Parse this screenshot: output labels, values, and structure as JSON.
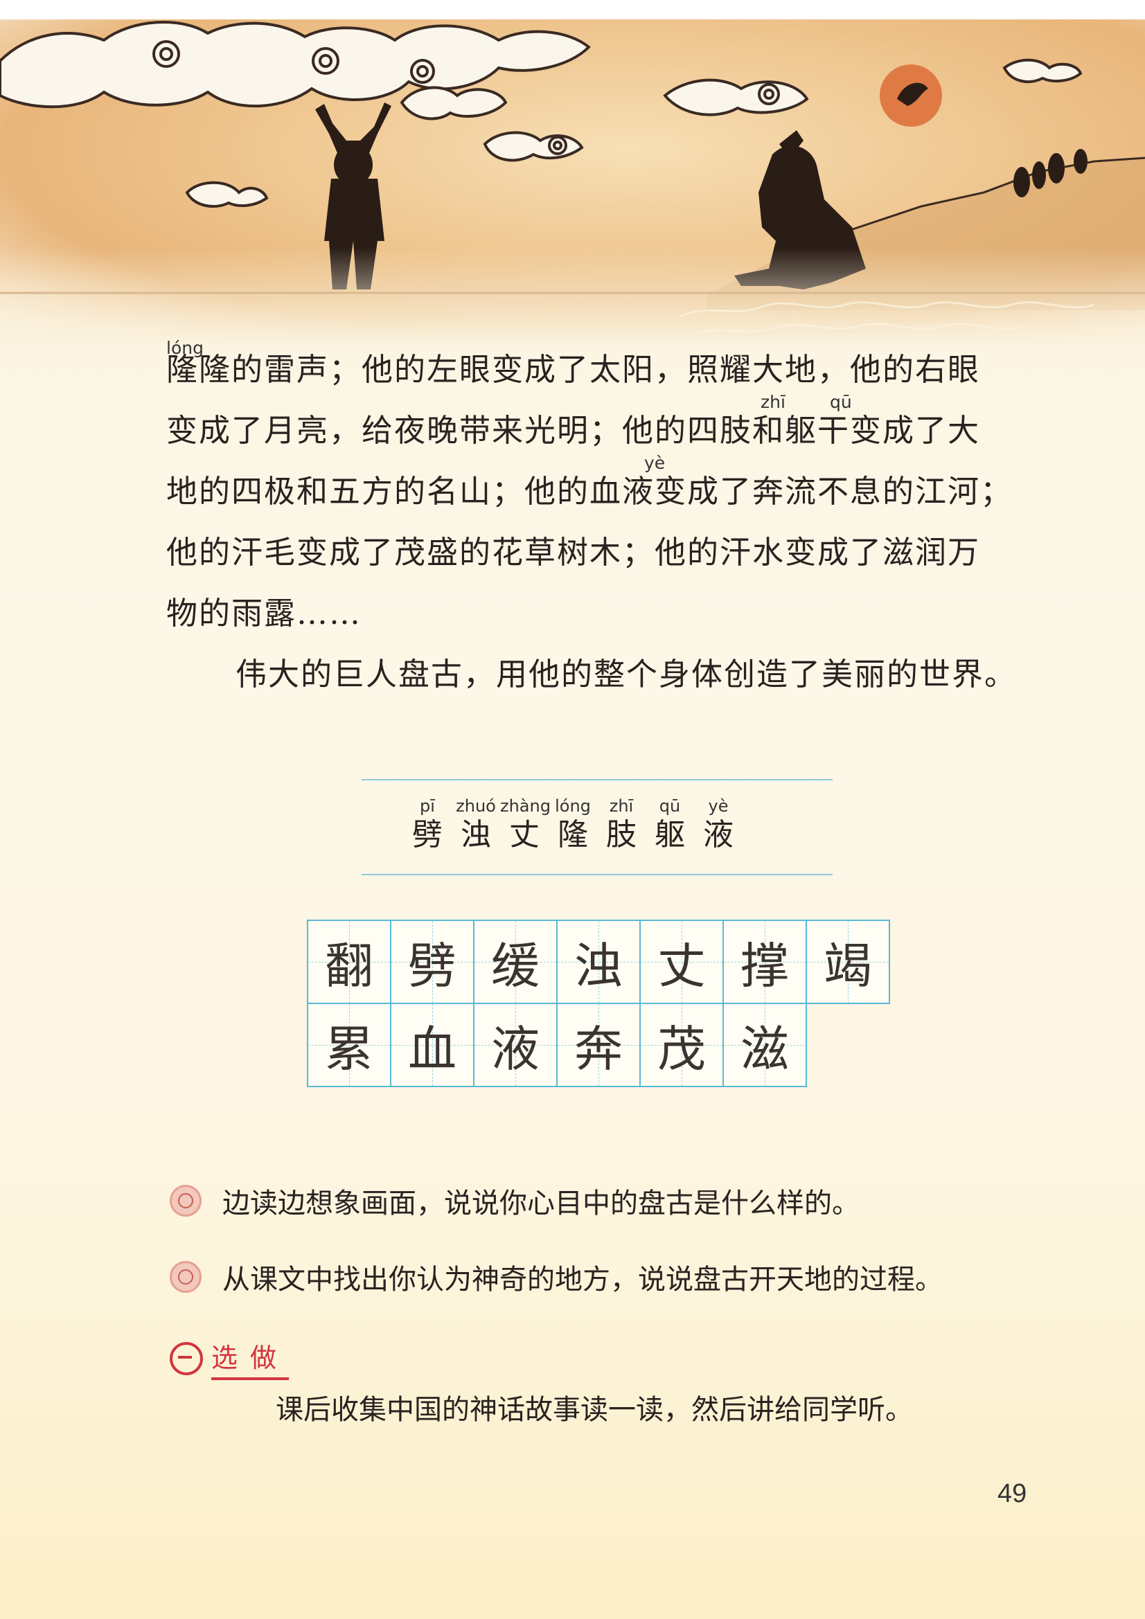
{
  "body": {
    "lines": [
      "隆隆的雷声；他的左眼变成了太阳，照耀大地，他的右眼",
      "变成了月亮，给夜晚带来光明；他的四肢和躯干变成了大",
      "地的四极和五方的名山；他的血液变成了奔流不息的江河；",
      "他的汗毛变成了茂盛的花草树木；他的汗水变成了滋润万",
      "物的雨露……"
    ],
    "paragraph2": "伟大的巨人盘古，用他的整个身体创造了美丽的世界。",
    "pinyin": {
      "long": "lóng",
      "zhi": "zhī",
      "qu": "qū",
      "ye": "yè"
    }
  },
  "words": [
    {
      "py": "pī",
      "ch": "劈"
    },
    {
      "py": "zhuó",
      "ch": "浊"
    },
    {
      "py": "zhàng",
      "ch": "丈"
    },
    {
      "py": "lóng",
      "ch": "隆"
    },
    {
      "py": "zhī",
      "ch": "肢"
    },
    {
      "py": "qū",
      "ch": "躯"
    },
    {
      "py": "yè",
      "ch": "液"
    }
  ],
  "writing_grid": {
    "row1": [
      "翻",
      "劈",
      "缓",
      "浊",
      "丈",
      "撑",
      "竭"
    ],
    "row2": [
      "累",
      "血",
      "液",
      "奔",
      "茂",
      "滋"
    ]
  },
  "tasks": [
    "边读边想象画面，说说你心目中的盘古是什么样的。",
    "从课文中找出你认为神奇的地方，说说盘古开天地的过程。"
  ],
  "optional": {
    "label": "选做",
    "text": "课后收集中国的神话故事读一读，然后讲给同学听。"
  },
  "page_number": "49"
}
